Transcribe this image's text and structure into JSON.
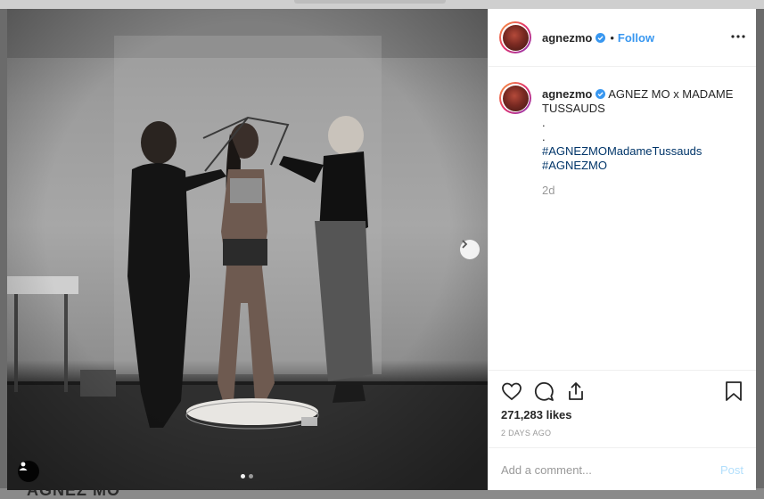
{
  "post": {
    "username": "agnezmo",
    "follow_label": "Follow",
    "separator": "•",
    "caption": {
      "title": "AGNEZ MO x MADAME TUSSAUDS",
      "dot_lines": [
        ".",
        "."
      ],
      "hashtags": [
        "#AGNEZMOMadameTussauds",
        "#AGNEZMO"
      ],
      "age": "2d"
    },
    "likes": "271,283 likes",
    "time_ago": "2 DAYS AGO",
    "comment_placeholder": "Add a comment...",
    "post_label": "Post"
  },
  "backdrop": {
    "ghost_text": "AGNEZ MO"
  },
  "carousel": {
    "slides": 2,
    "active_index": 0
  },
  "icons": {
    "verified": "verified-badge-icon",
    "more": "more-options-icon",
    "like": "heart-icon",
    "comment": "comment-icon",
    "share": "share-icon",
    "save": "bookmark-icon",
    "next": "chevron-right-icon",
    "tag": "user-tag-icon"
  },
  "colors": {
    "link_blue": "#3897f0",
    "hashtag": "#003569",
    "post_disabled": "#b2dffc",
    "text": "#262626",
    "muted": "#999999"
  }
}
